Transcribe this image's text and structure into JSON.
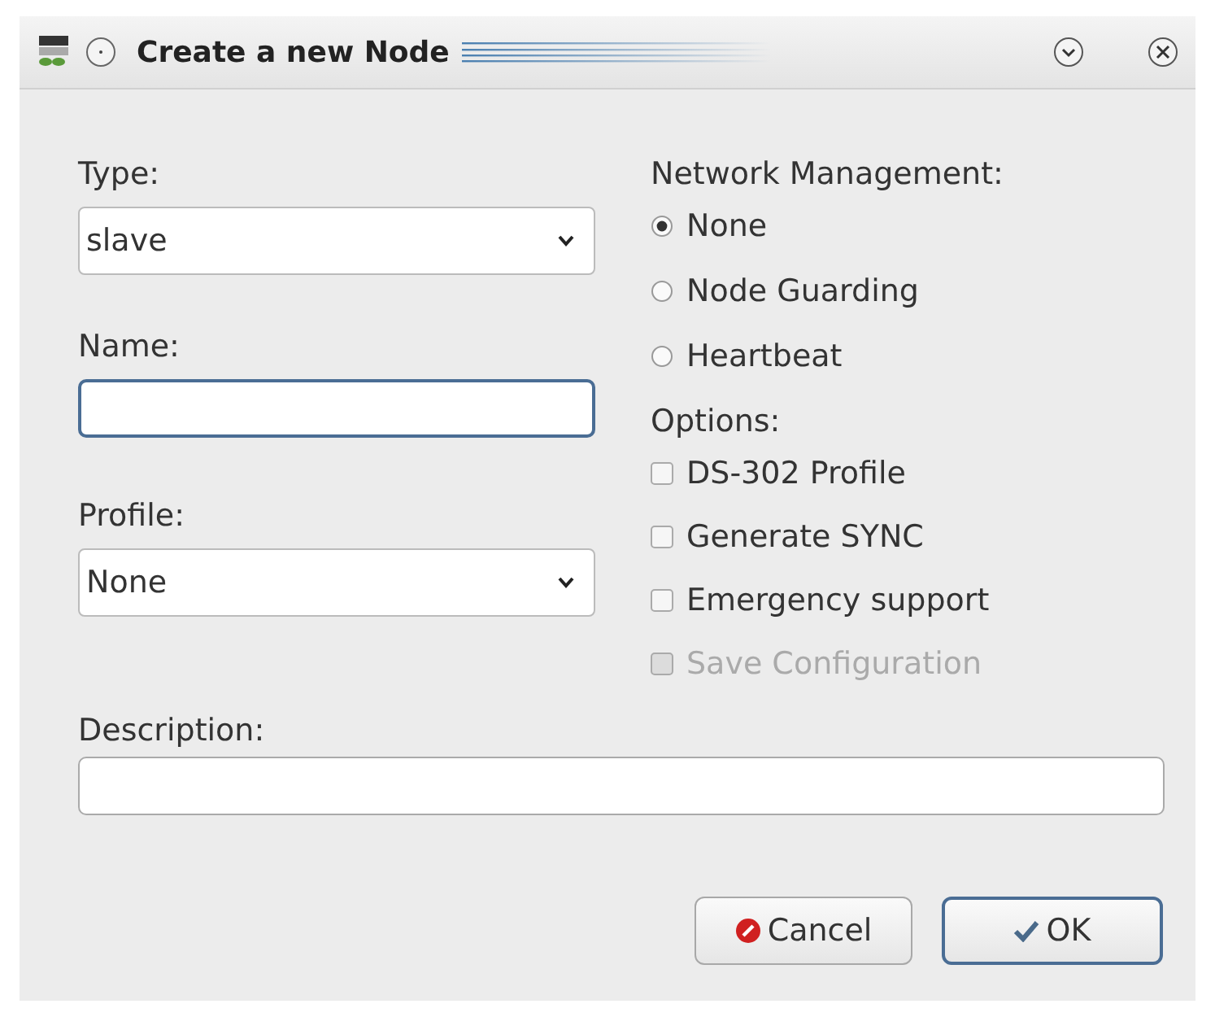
{
  "window": {
    "title": "Create a new Node"
  },
  "type": {
    "label": "Type:",
    "value": "slave"
  },
  "name": {
    "label": "Name:"
  },
  "profile": {
    "label": "Profile:",
    "value": "None"
  },
  "network_management": {
    "label": "Network Management:",
    "options": [
      {
        "label": "None",
        "selected": true
      },
      {
        "label": "Node Guarding",
        "selected": false
      },
      {
        "label": "Heartbeat",
        "selected": false
      }
    ]
  },
  "options": {
    "label": "Options:",
    "items": [
      {
        "label": "DS-302 Profile",
        "checked": false,
        "disabled": false
      },
      {
        "label": "Generate SYNC",
        "checked": false,
        "disabled": false
      },
      {
        "label": "Emergency support",
        "checked": false,
        "disabled": false
      },
      {
        "label": "Save Configuration",
        "checked": false,
        "disabled": true
      }
    ]
  },
  "description": {
    "label": "Description:"
  },
  "buttons": [
    {
      "kind": "cancel",
      "label": "Cancel",
      "default": false
    },
    {
      "kind": "ok",
      "label": "OK",
      "default": true
    }
  ]
}
